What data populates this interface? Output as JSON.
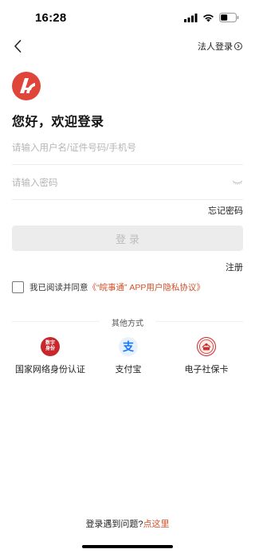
{
  "status_bar": {
    "time": "16:28"
  },
  "nav": {
    "corp_login_label": "法人登录"
  },
  "greeting": "您好，欢迎登录",
  "form": {
    "username_placeholder": "请输入用户名/证件号码/手机号",
    "username_value": "",
    "password_placeholder": "请输入密码",
    "password_value": "",
    "forgot_label": "忘记密码",
    "login_label": "登录",
    "register_label": "注册"
  },
  "agreement": {
    "prefix": "我已阅读并同意",
    "link": "《“皖事通” APP用户隐私协议》"
  },
  "other_methods": {
    "title": "其他方式",
    "items": [
      {
        "label": "国家网络身份认证",
        "icon_text": "数字身份",
        "icon": "digital-id-icon"
      },
      {
        "label": "支付宝",
        "icon": "alipay-icon",
        "icon_glyph": "支"
      },
      {
        "label": "电子社保卡",
        "icon": "social-security-card-icon"
      }
    ]
  },
  "help": {
    "prefix": "登录遇到问题?",
    "link": "点这里"
  },
  "colors": {
    "accent": "#d2502a",
    "brand": "#e0453a",
    "alipay": "#1677ff",
    "disabled_button": "#ececec"
  }
}
